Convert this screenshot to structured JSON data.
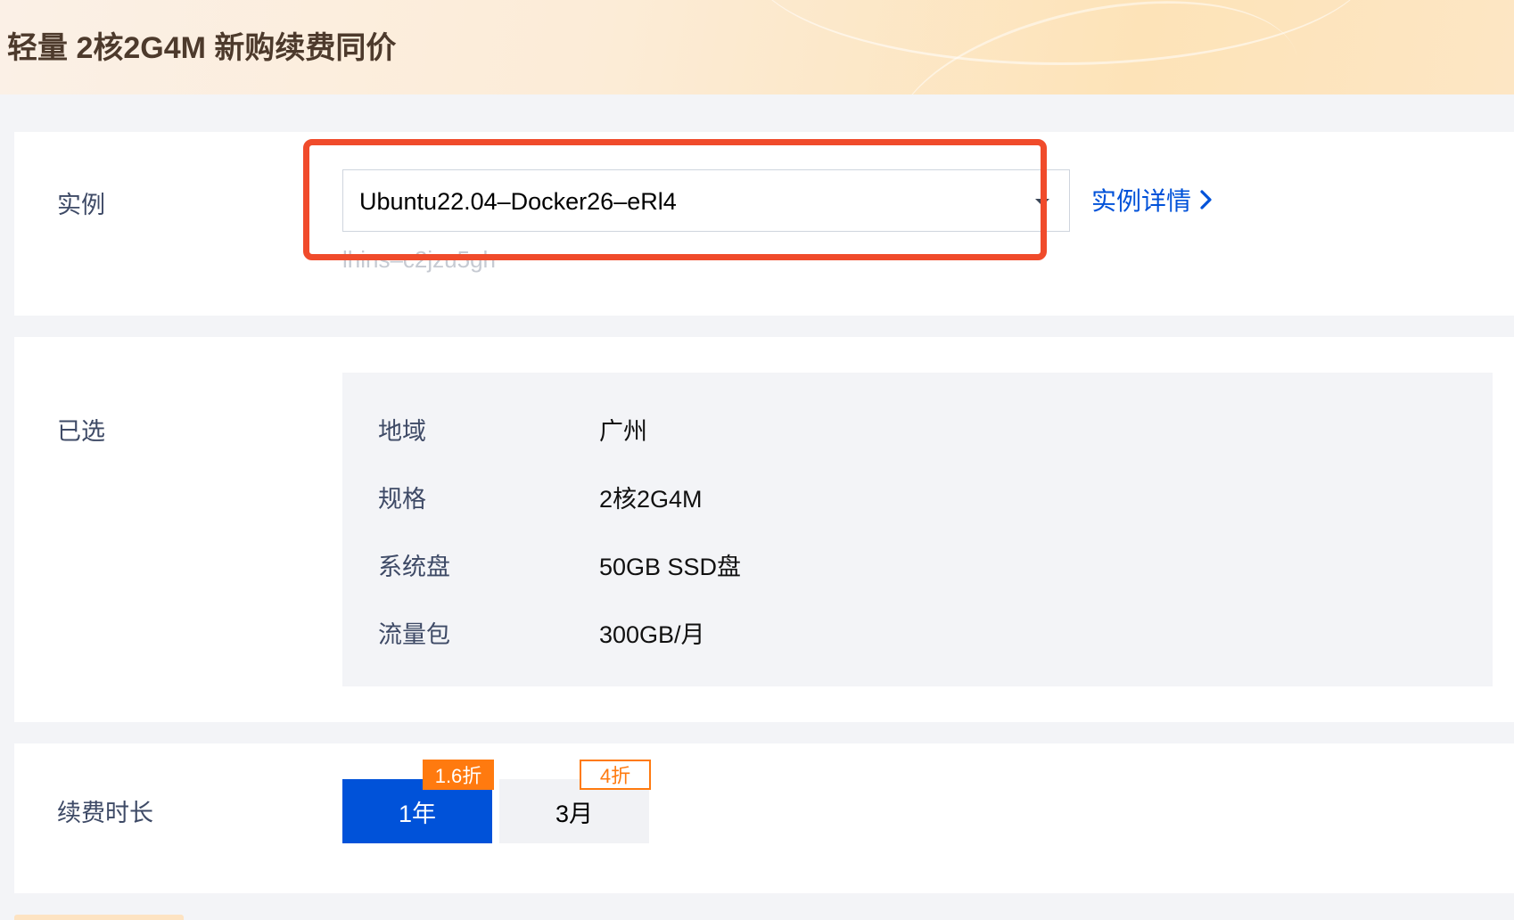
{
  "header": {
    "title": "轻量 2核2G4M 新购续费同价"
  },
  "instance": {
    "label": "实例",
    "selected_value": "Ubuntu22.04–Docker26–eRl4",
    "instance_id": "lhins–c2jzu5gh",
    "detail_link": "实例详情"
  },
  "selected": {
    "label": "已选",
    "rows": [
      {
        "key": "地域",
        "value": "广州"
      },
      {
        "key": "规格",
        "value": "2核2G4M"
      },
      {
        "key": "系统盘",
        "value": "50GB SSD盘"
      },
      {
        "key": "流量包",
        "value": "300GB/月"
      }
    ]
  },
  "renewal": {
    "label": "续费时长",
    "options": [
      {
        "label": "1年",
        "badge": "1.6折",
        "active": true
      },
      {
        "label": "3月",
        "badge": "4折",
        "active": false
      }
    ]
  },
  "colors": {
    "accent": "#0052d9",
    "highlight": "#f04b2b",
    "discount": "#ff7a0f",
    "title": "#4d3a2c"
  },
  "icons": {
    "dropdown": "caret-down-icon",
    "link_arrow": "chevron-right-icon"
  }
}
